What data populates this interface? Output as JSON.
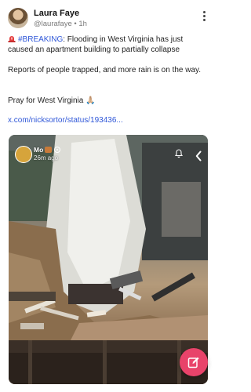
{
  "post": {
    "author_name": "Laura Faye",
    "handle": "@laurafaye",
    "separator": "•",
    "time": "1h",
    "hashtag": "#BREAKING",
    "line1_rest": ": Flooding in West Virginia has just caused an apartment building to partially collapse",
    "line2": "Reports of people trapped, and more rain is on the way.",
    "line3": "Pray for West Virginia 🙏🏼",
    "link": "x.com/nicksortor/status/193436..."
  },
  "media": {
    "story_user": "Mo",
    "story_time": "26m ago"
  },
  "colors": {
    "link": "#2f57d8",
    "compose_button": "#e8436a"
  },
  "icons": [
    "siren-icon",
    "more-options-icon",
    "story-fire-emoji",
    "live-dot-icon",
    "bell-icon",
    "chevron-left-icon",
    "compose-icon"
  ]
}
